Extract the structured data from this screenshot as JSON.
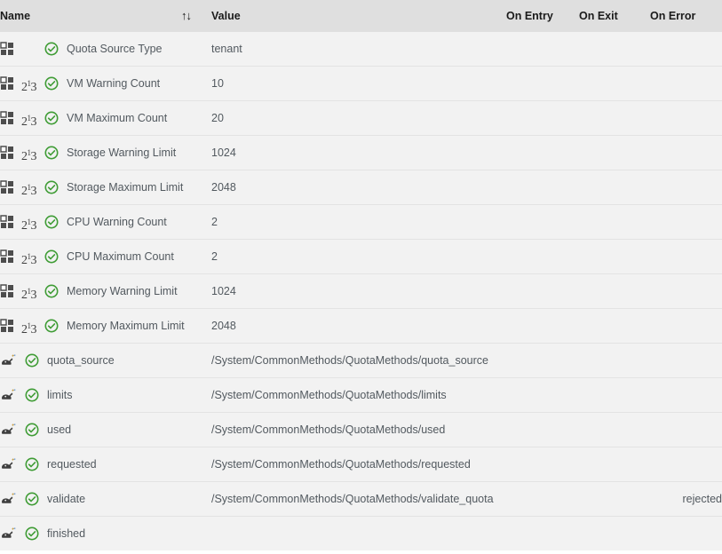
{
  "table": {
    "columns": [
      {
        "key": "name",
        "label": "Name"
      },
      {
        "key": "value",
        "label": "Value"
      },
      {
        "key": "onentry",
        "label": "On Entry"
      },
      {
        "key": "onexit",
        "label": "On Exit"
      },
      {
        "key": "onerror",
        "label": "On Error"
      }
    ],
    "sort_icon": "sort-ascending-descending-icon",
    "rows": [
      {
        "icons": [
          "grid-icon",
          "check-circle-icon"
        ],
        "has_number_icon": false,
        "name": "Quota Source Type",
        "value": "tenant",
        "onentry": "",
        "onexit": "",
        "onerror": ""
      },
      {
        "icons": [
          "grid-icon",
          "number-icon",
          "check-circle-icon"
        ],
        "has_number_icon": true,
        "name": "VM Warning Count",
        "value": "10",
        "onentry": "",
        "onexit": "",
        "onerror": ""
      },
      {
        "icons": [
          "grid-icon",
          "number-icon",
          "check-circle-icon"
        ],
        "has_number_icon": true,
        "name": "VM Maximum Count",
        "value": "20",
        "onentry": "",
        "onexit": "",
        "onerror": ""
      },
      {
        "icons": [
          "grid-icon",
          "number-icon",
          "check-circle-icon"
        ],
        "has_number_icon": true,
        "name": "Storage Warning Limit",
        "value": "1024",
        "onentry": "",
        "onexit": "",
        "onerror": ""
      },
      {
        "icons": [
          "grid-icon",
          "number-icon",
          "check-circle-icon"
        ],
        "has_number_icon": true,
        "name": "Storage Maximum Limit",
        "value": "2048",
        "onentry": "",
        "onexit": "",
        "onerror": ""
      },
      {
        "icons": [
          "grid-icon",
          "number-icon",
          "check-circle-icon"
        ],
        "has_number_icon": true,
        "name": "CPU Warning Count",
        "value": "2",
        "onentry": "",
        "onexit": "",
        "onerror": ""
      },
      {
        "icons": [
          "grid-icon",
          "number-icon",
          "check-circle-icon"
        ],
        "has_number_icon": true,
        "name": "CPU Maximum Count",
        "value": "2",
        "onentry": "",
        "onexit": "",
        "onerror": ""
      },
      {
        "icons": [
          "grid-icon",
          "number-icon",
          "check-circle-icon"
        ],
        "has_number_icon": true,
        "name": "Memory Warning Limit",
        "value": "1024",
        "onentry": "",
        "onexit": "",
        "onerror": ""
      },
      {
        "icons": [
          "grid-icon",
          "number-icon",
          "check-circle-icon"
        ],
        "has_number_icon": true,
        "name": "Memory Maximum Limit",
        "value": "2048",
        "onentry": "",
        "onexit": "",
        "onerror": ""
      },
      {
        "icons": [
          "ruby-method-icon",
          "check-circle-icon"
        ],
        "has_number_icon": false,
        "name": "quota_source",
        "value": "/System/CommonMethods/QuotaMethods/quota_source",
        "onentry": "",
        "onexit": "",
        "onerror": ""
      },
      {
        "icons": [
          "ruby-method-icon",
          "check-circle-icon"
        ],
        "has_number_icon": false,
        "name": "limits",
        "value": "/System/CommonMethods/QuotaMethods/limits",
        "onentry": "",
        "onexit": "",
        "onerror": ""
      },
      {
        "icons": [
          "ruby-method-icon",
          "check-circle-icon"
        ],
        "has_number_icon": false,
        "name": "used",
        "value": "/System/CommonMethods/QuotaMethods/used",
        "onentry": "",
        "onexit": "",
        "onerror": ""
      },
      {
        "icons": [
          "ruby-method-icon",
          "check-circle-icon"
        ],
        "has_number_icon": false,
        "name": "requested",
        "value": "/System/CommonMethods/QuotaMethods/requested",
        "onentry": "",
        "onexit": "",
        "onerror": ""
      },
      {
        "icons": [
          "ruby-method-icon",
          "check-circle-icon"
        ],
        "has_number_icon": false,
        "name": "validate",
        "value": "/System/CommonMethods/QuotaMethods/validate_quota",
        "onentry": "",
        "onexit": "",
        "onerror": "rejected"
      },
      {
        "icons": [
          "ruby-method-icon",
          "check-circle-icon"
        ],
        "has_number_icon": false,
        "name": "finished",
        "value": "",
        "onentry": "",
        "onexit": "",
        "onerror": ""
      }
    ]
  },
  "colors": {
    "header_background": "#dfdfdf",
    "row_background": "#f2f2f2",
    "row_divider": "#e3e3e3",
    "text": "#52595f",
    "header_text": "#1b1b1b",
    "check_green": "#3f9c35",
    "grid_square": "#4d4d4d"
  }
}
